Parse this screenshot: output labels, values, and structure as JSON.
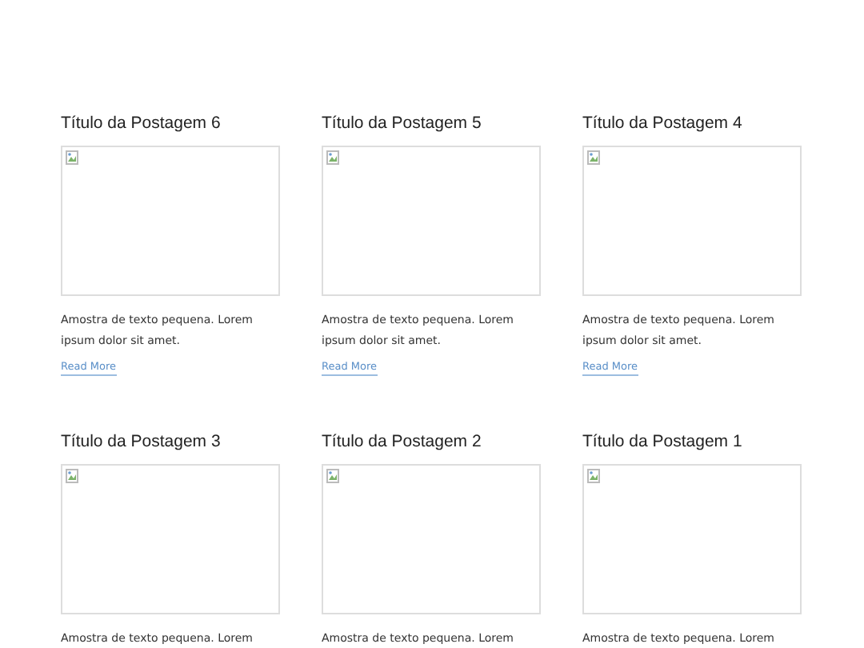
{
  "posts": [
    {
      "title": "Título da Postagem 6",
      "excerpt": "Amostra de texto pequena. Lorem ipsum dolor sit amet.",
      "link": "Read More"
    },
    {
      "title": "Título da Postagem 5",
      "excerpt": "Amostra de texto pequena. Lorem ipsum dolor sit amet.",
      "link": "Read More"
    },
    {
      "title": "Título da Postagem 4",
      "excerpt": "Amostra de texto pequena. Lorem ipsum dolor sit amet.",
      "link": "Read More"
    },
    {
      "title": "Título da Postagem 3",
      "excerpt": "Amostra de texto pequena. Lorem"
    },
    {
      "title": "Título da Postagem 2",
      "excerpt": "Amostra de texto pequena. Lorem"
    },
    {
      "title": "Título da Postagem 1",
      "excerpt": "Amostra de texto pequena. Lorem"
    }
  ]
}
